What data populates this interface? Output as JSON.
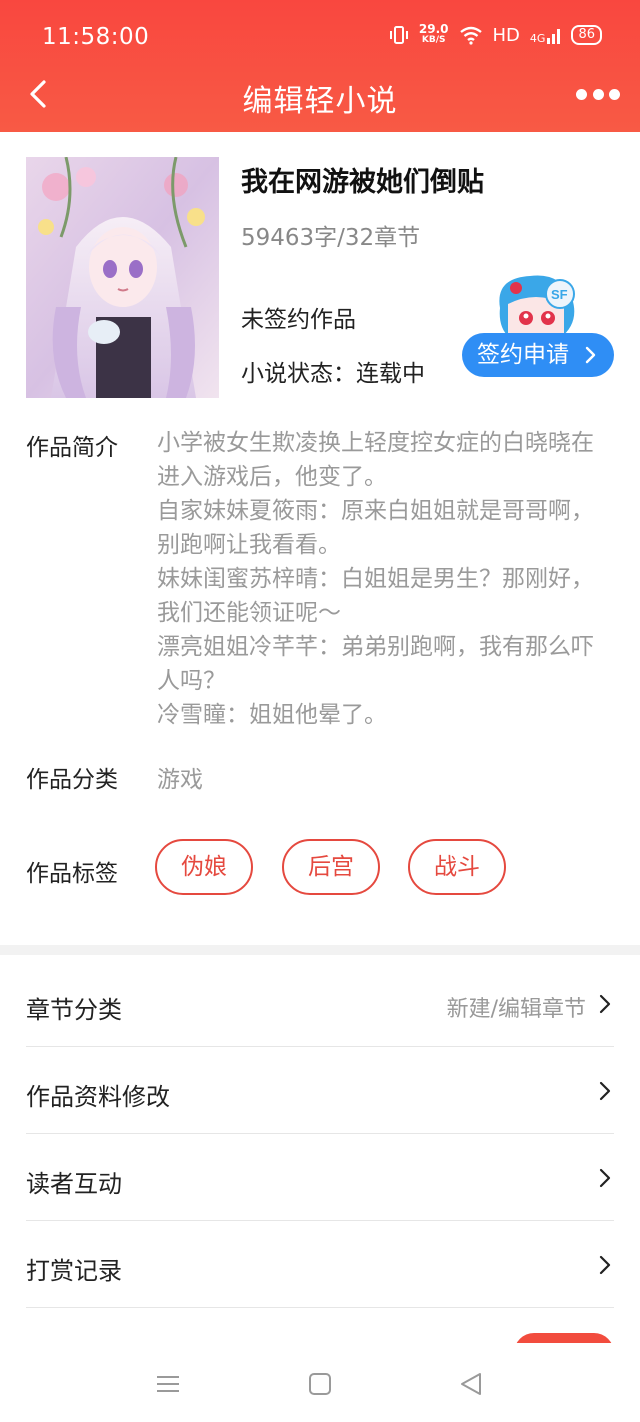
{
  "status_bar": {
    "time": "11:58:00",
    "net_speed_value": "29.0",
    "net_speed_unit": "KB/S",
    "hd": "HD",
    "signal": "4G",
    "battery": "86"
  },
  "nav": {
    "title": "编辑轻小说"
  },
  "book": {
    "title": "我在网游被她们倒贴",
    "stats": "59463字/32章节",
    "sign_status": "未签约作品",
    "novel_status": "小说状态：连载中",
    "sign_button": "签约申请"
  },
  "details": {
    "intro_label": "作品简介",
    "intro_lines": [
      "小学被女生欺凌换上轻度控女症的白晓晓在进入游戏后，他变了。",
      "自家妹妹夏筱雨：原来白姐姐就是哥哥啊，别跑啊让我看看。",
      "妹妹闺蜜苏梓晴：白姐姐是男生？那刚好，我们还能领证呢～",
      "漂亮姐姐冷芊芊：弟弟别跑啊，我有那么吓人吗？",
      "冷雪瞳：姐姐他晕了。"
    ],
    "category_label": "作品分类",
    "category_value": "游戏",
    "tags_label": "作品标签",
    "tags": [
      "伪娘",
      "后宫",
      "战斗"
    ]
  },
  "menu": [
    {
      "label": "章节分类",
      "value": "新建/编辑章节"
    },
    {
      "label": "作品资料修改",
      "value": ""
    },
    {
      "label": "读者互动",
      "value": ""
    },
    {
      "label": "打赏记录",
      "value": ""
    }
  ],
  "colors": {
    "header": "#f9473f",
    "accent": "#e5493f",
    "sign_button": "#2f8ef5"
  },
  "icons": {
    "back": "chevron-left-icon",
    "more": "more-dots-icon",
    "row": "chevron-right-icon"
  }
}
